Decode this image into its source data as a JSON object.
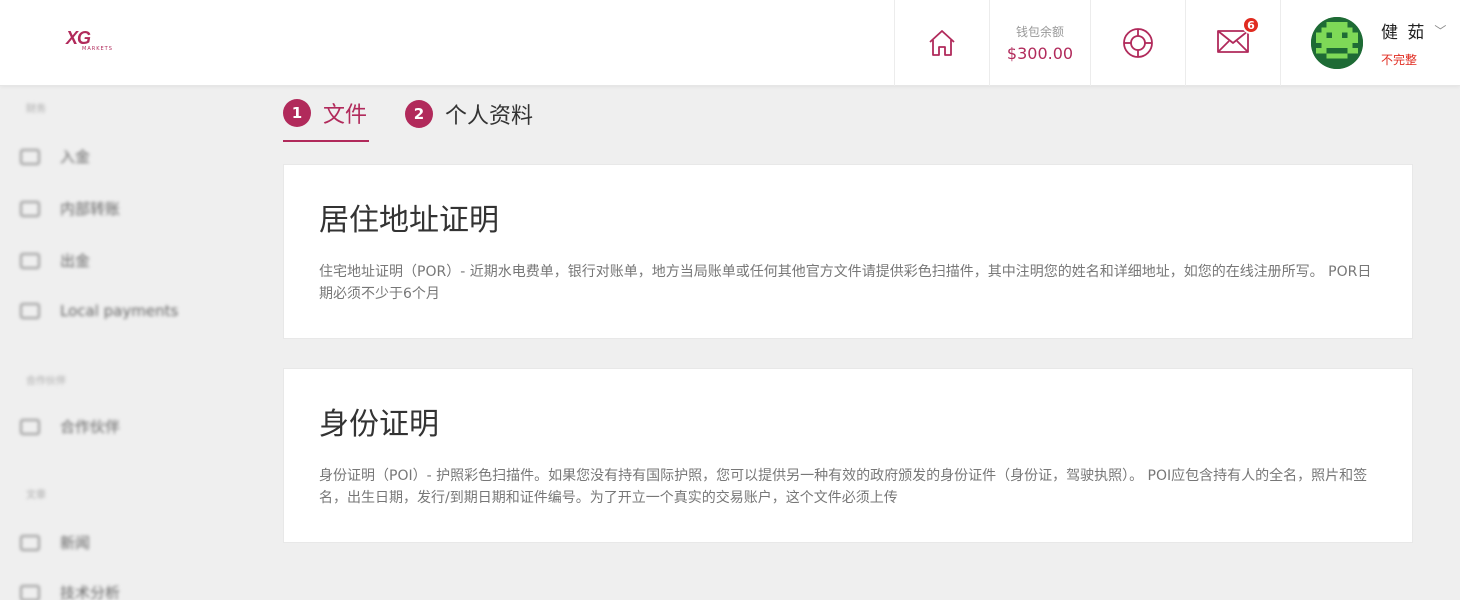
{
  "header": {
    "logo": {
      "text": "XG",
      "subtext": "MARKETS"
    },
    "wallet": {
      "label": "钱包余额",
      "amount": "$300.00"
    },
    "mail_badge": "6",
    "user": {
      "name": "健 茹",
      "status": "不完整"
    }
  },
  "sidebar": {
    "sections": [
      "财务",
      "合作伙伴",
      "文章"
    ],
    "items": [
      {
        "label": "入金",
        "icon": "wallet-icon"
      },
      {
        "label": "内部转账",
        "icon": "transfer-icon"
      },
      {
        "label": "出金",
        "icon": "withdraw-icon"
      },
      {
        "label": "Local payments",
        "icon": "wallet-icon"
      },
      {
        "label": "合作伙伴",
        "icon": "handshake-icon"
      },
      {
        "label": "新闻",
        "icon": "news-icon"
      },
      {
        "label": "技术分析",
        "icon": "analysis-icon"
      }
    ]
  },
  "tabs": [
    {
      "num": "1",
      "label": "文件"
    },
    {
      "num": "2",
      "label": "个人资料"
    }
  ],
  "cards": [
    {
      "title": "居住地址证明",
      "text": "住宅地址证明（POR）- 近期水电费单，银行对账单，地方当局账单或任何其他官方文件请提供彩色扫描件，其中注明您的姓名和详细地址，如您的在线注册所写。 POR日期必须不少于6个月"
    },
    {
      "title": "身份证明",
      "text": "身份证明（POI）- 护照彩色扫描件。如果您没有持有国际护照，您可以提供另一种有效的政府颁发的身份证件（身份证，驾驶执照）。 POI应包含持有人的全名，照片和签名，出生日期，发行/到期日期和证件编号。为了开立一个真实的交易账户，这个文件必须上传"
    }
  ],
  "colors": {
    "brand": "#b12a5b",
    "alert": "#e02b20",
    "avatar_bg": "#1e6b35"
  }
}
